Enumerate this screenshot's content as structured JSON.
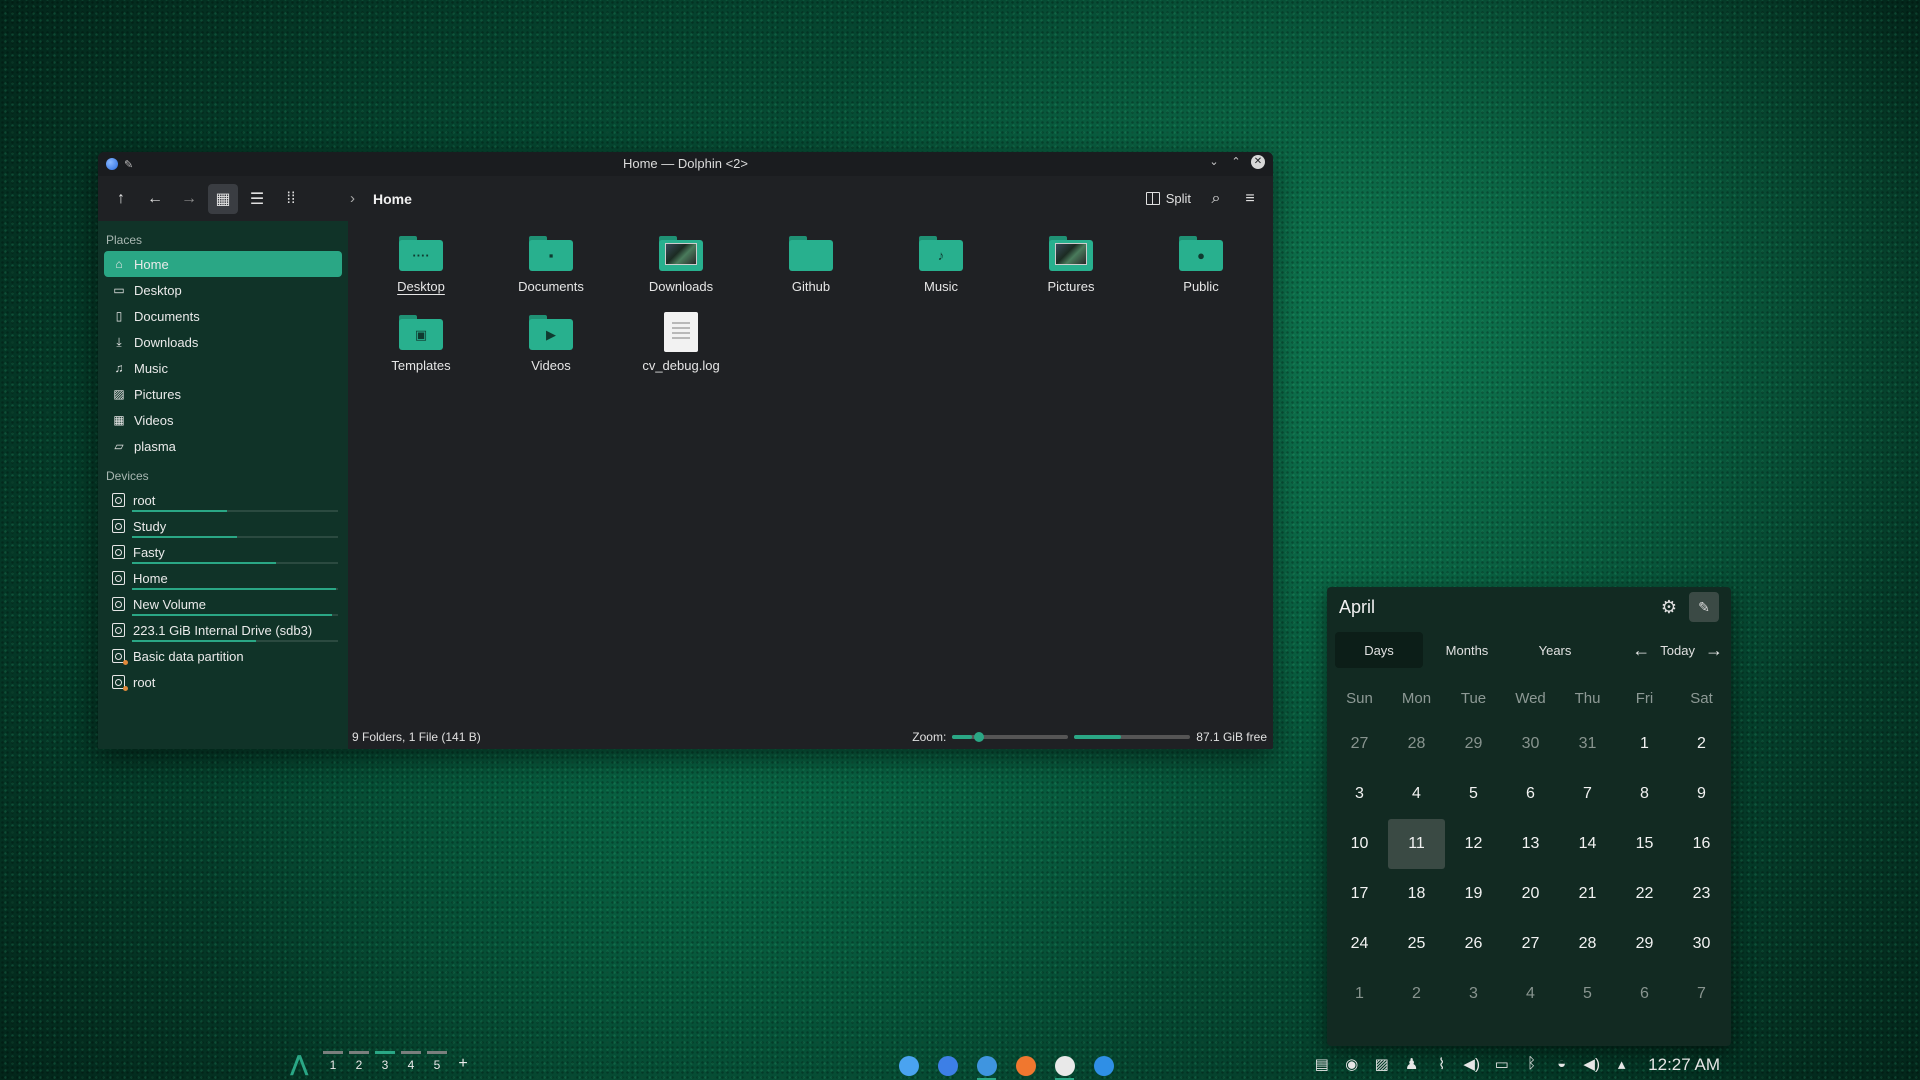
{
  "window": {
    "title": "Home — Dolphin <2>",
    "breadcrumb": "Home",
    "split_label": "Split"
  },
  "sidebar": {
    "places_heading": "Places",
    "places": [
      {
        "label": "Home",
        "icon": "home-icon",
        "selected": true
      },
      {
        "label": "Desktop",
        "icon": "desktop-icon"
      },
      {
        "label": "Documents",
        "icon": "document-icon"
      },
      {
        "label": "Downloads",
        "icon": "download-icon"
      },
      {
        "label": "Music",
        "icon": "music-icon"
      },
      {
        "label": "Pictures",
        "icon": "picture-icon"
      },
      {
        "label": "Videos",
        "icon": "video-icon"
      },
      {
        "label": "plasma",
        "icon": "folder-icon"
      }
    ],
    "devices_heading": "Devices",
    "devices": [
      {
        "label": "root",
        "usage": 0.46
      },
      {
        "label": "Study",
        "usage": 0.51
      },
      {
        "label": "Fasty",
        "usage": 0.7
      },
      {
        "label": "Home",
        "usage": 0.99
      },
      {
        "label": "New Volume",
        "usage": 0.97
      },
      {
        "label": "223.1 GiB Internal Drive (sdb3)",
        "usage": 0.6
      },
      {
        "label": "Basic data partition",
        "usage": null
      },
      {
        "label": "root",
        "usage": null
      }
    ]
  },
  "files": [
    {
      "name": "Desktop",
      "type": "folder",
      "glyph": "····"
    },
    {
      "name": "Documents",
      "type": "folder",
      "glyph": "▪"
    },
    {
      "name": "Downloads",
      "type": "folder-image"
    },
    {
      "name": "Github",
      "type": "folder",
      "glyph": ""
    },
    {
      "name": "Music",
      "type": "folder",
      "glyph": "♪"
    },
    {
      "name": "Pictures",
      "type": "folder-image"
    },
    {
      "name": "Public",
      "type": "folder",
      "glyph": "●"
    },
    {
      "name": "Templates",
      "type": "folder",
      "glyph": "▣"
    },
    {
      "name": "Videos",
      "type": "folder",
      "glyph": "▶"
    },
    {
      "name": "cv_debug.log",
      "type": "document"
    }
  ],
  "status": {
    "summary": "9 Folders, 1 File (141 B)",
    "zoom_label": "Zoom:",
    "free_space": "87.1 GiB free",
    "free_fraction": 0.4
  },
  "calendar": {
    "month": "April",
    "tabs": [
      "Days",
      "Months",
      "Years"
    ],
    "active_tab": "Days",
    "today_label": "Today",
    "weekdays": [
      "Sun",
      "Mon",
      "Tue",
      "Wed",
      "Thu",
      "Fri",
      "Sat"
    ],
    "days": [
      {
        "d": "27",
        "m": true
      },
      {
        "d": "28",
        "m": true
      },
      {
        "d": "29",
        "m": true
      },
      {
        "d": "30",
        "m": true
      },
      {
        "d": "31",
        "m": true
      },
      {
        "d": "1"
      },
      {
        "d": "2"
      },
      {
        "d": "3"
      },
      {
        "d": "4"
      },
      {
        "d": "5"
      },
      {
        "d": "6"
      },
      {
        "d": "7"
      },
      {
        "d": "8"
      },
      {
        "d": "9"
      },
      {
        "d": "10"
      },
      {
        "d": "11",
        "today": true
      },
      {
        "d": "12"
      },
      {
        "d": "13"
      },
      {
        "d": "14"
      },
      {
        "d": "15"
      },
      {
        "d": "16"
      },
      {
        "d": "17"
      },
      {
        "d": "18"
      },
      {
        "d": "19"
      },
      {
        "d": "20"
      },
      {
        "d": "21"
      },
      {
        "d": "22"
      },
      {
        "d": "23"
      },
      {
        "d": "24"
      },
      {
        "d": "25"
      },
      {
        "d": "26"
      },
      {
        "d": "27"
      },
      {
        "d": "28"
      },
      {
        "d": "29"
      },
      {
        "d": "30"
      },
      {
        "d": "1",
        "m": true
      },
      {
        "d": "2",
        "m": true
      },
      {
        "d": "3",
        "m": true
      },
      {
        "d": "4",
        "m": true
      },
      {
        "d": "5",
        "m": true
      },
      {
        "d": "6",
        "m": true
      },
      {
        "d": "7",
        "m": true
      }
    ]
  },
  "taskbar": {
    "desktops": [
      "1",
      "2",
      "3",
      "4",
      "5"
    ],
    "current_desktop": "3",
    "add_desktop": "+",
    "tasks": [
      {
        "name": "finder-icon",
        "color": "#4aa3f0"
      },
      {
        "name": "dolphin-icon",
        "color": "#3d7fe6"
      },
      {
        "name": "chromium-icon",
        "color": "#3f95e0"
      },
      {
        "name": "brave-icon",
        "color": "#f0772f"
      },
      {
        "name": "github-icon",
        "color": "#e9e9e9"
      },
      {
        "name": "vscode-icon",
        "color": "#2f8fe6"
      }
    ],
    "clock": "12:27 AM"
  },
  "colors": {
    "accent": "#2aa785",
    "sidebar_bg": "#103328",
    "window_bg": "#1f2124"
  }
}
